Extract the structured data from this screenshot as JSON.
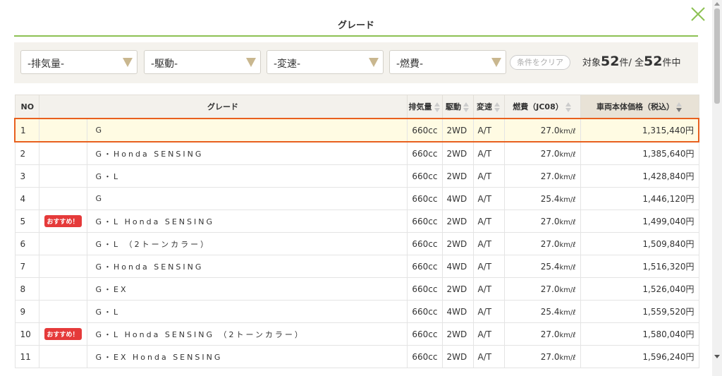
{
  "header": {
    "title": "グレード"
  },
  "filters": {
    "displacement": "-排気量-",
    "drive": "-駆動-",
    "transmission": "-変速-",
    "fuel": "-燃費-",
    "clear_label": "条件をクリア",
    "count_prefix": "対象",
    "count_target": "52",
    "count_unit1": "件/ 全",
    "count_total": "52",
    "count_unit2": "件中"
  },
  "table": {
    "headers": {
      "no": "NO",
      "grade": "グレード",
      "displacement": "排気量",
      "drive": "駆動",
      "transmission": "変速",
      "fuel": "燃費（JC08）",
      "price": "車両本体価格（税込）"
    },
    "fuel_unit": "km/ℓ",
    "badge_label": "おすすめ！",
    "rows": [
      {
        "no": "1",
        "badge": "",
        "grade": "G",
        "disp": "660cc",
        "drive": "2WD",
        "trans": "A/T",
        "fuel": "27.0",
        "price": "1,315,440円"
      },
      {
        "no": "2",
        "badge": "",
        "grade": "G・Honda SENSING",
        "disp": "660cc",
        "drive": "2WD",
        "trans": "A/T",
        "fuel": "27.0",
        "price": "1,385,640円"
      },
      {
        "no": "3",
        "badge": "",
        "grade": "G・L",
        "disp": "660cc",
        "drive": "2WD",
        "trans": "A/T",
        "fuel": "27.0",
        "price": "1,428,840円"
      },
      {
        "no": "4",
        "badge": "",
        "grade": "G",
        "disp": "660cc",
        "drive": "4WD",
        "trans": "A/T",
        "fuel": "25.4",
        "price": "1,446,120円"
      },
      {
        "no": "5",
        "badge": "おすすめ！",
        "grade": "G・L Honda SENSING",
        "disp": "660cc",
        "drive": "2WD",
        "trans": "A/T",
        "fuel": "27.0",
        "price": "1,499,040円"
      },
      {
        "no": "6",
        "badge": "",
        "grade": "G・L （2トーンカラー）",
        "disp": "660cc",
        "drive": "2WD",
        "trans": "A/T",
        "fuel": "27.0",
        "price": "1,509,840円"
      },
      {
        "no": "7",
        "badge": "",
        "grade": "G・Honda SENSING",
        "disp": "660cc",
        "drive": "4WD",
        "trans": "A/T",
        "fuel": "25.4",
        "price": "1,516,320円"
      },
      {
        "no": "8",
        "badge": "",
        "grade": "G・EX",
        "disp": "660cc",
        "drive": "2WD",
        "trans": "A/T",
        "fuel": "27.0",
        "price": "1,526,040円"
      },
      {
        "no": "9",
        "badge": "",
        "grade": "G・L",
        "disp": "660cc",
        "drive": "4WD",
        "trans": "A/T",
        "fuel": "25.4",
        "price": "1,559,520円"
      },
      {
        "no": "10",
        "badge": "おすすめ！",
        "grade": "G・L Honda SENSING （2トーンカラー）",
        "disp": "660cc",
        "drive": "2WD",
        "trans": "A/T",
        "fuel": "27.0",
        "price": "1,580,040円"
      },
      {
        "no": "11",
        "badge": "",
        "grade": "G・EX Honda SENSING",
        "disp": "660cc",
        "drive": "2WD",
        "trans": "A/T",
        "fuel": "27.0",
        "price": "1,596,240円"
      }
    ]
  },
  "colors": {
    "accent_green": "#8dc153",
    "highlight_border": "#e8601e",
    "badge_red": "#e53a3a"
  },
  "icons": {
    "close": "close-icon",
    "dropdown": "triangle-down-icon",
    "sort": "sort-arrows-icon"
  }
}
